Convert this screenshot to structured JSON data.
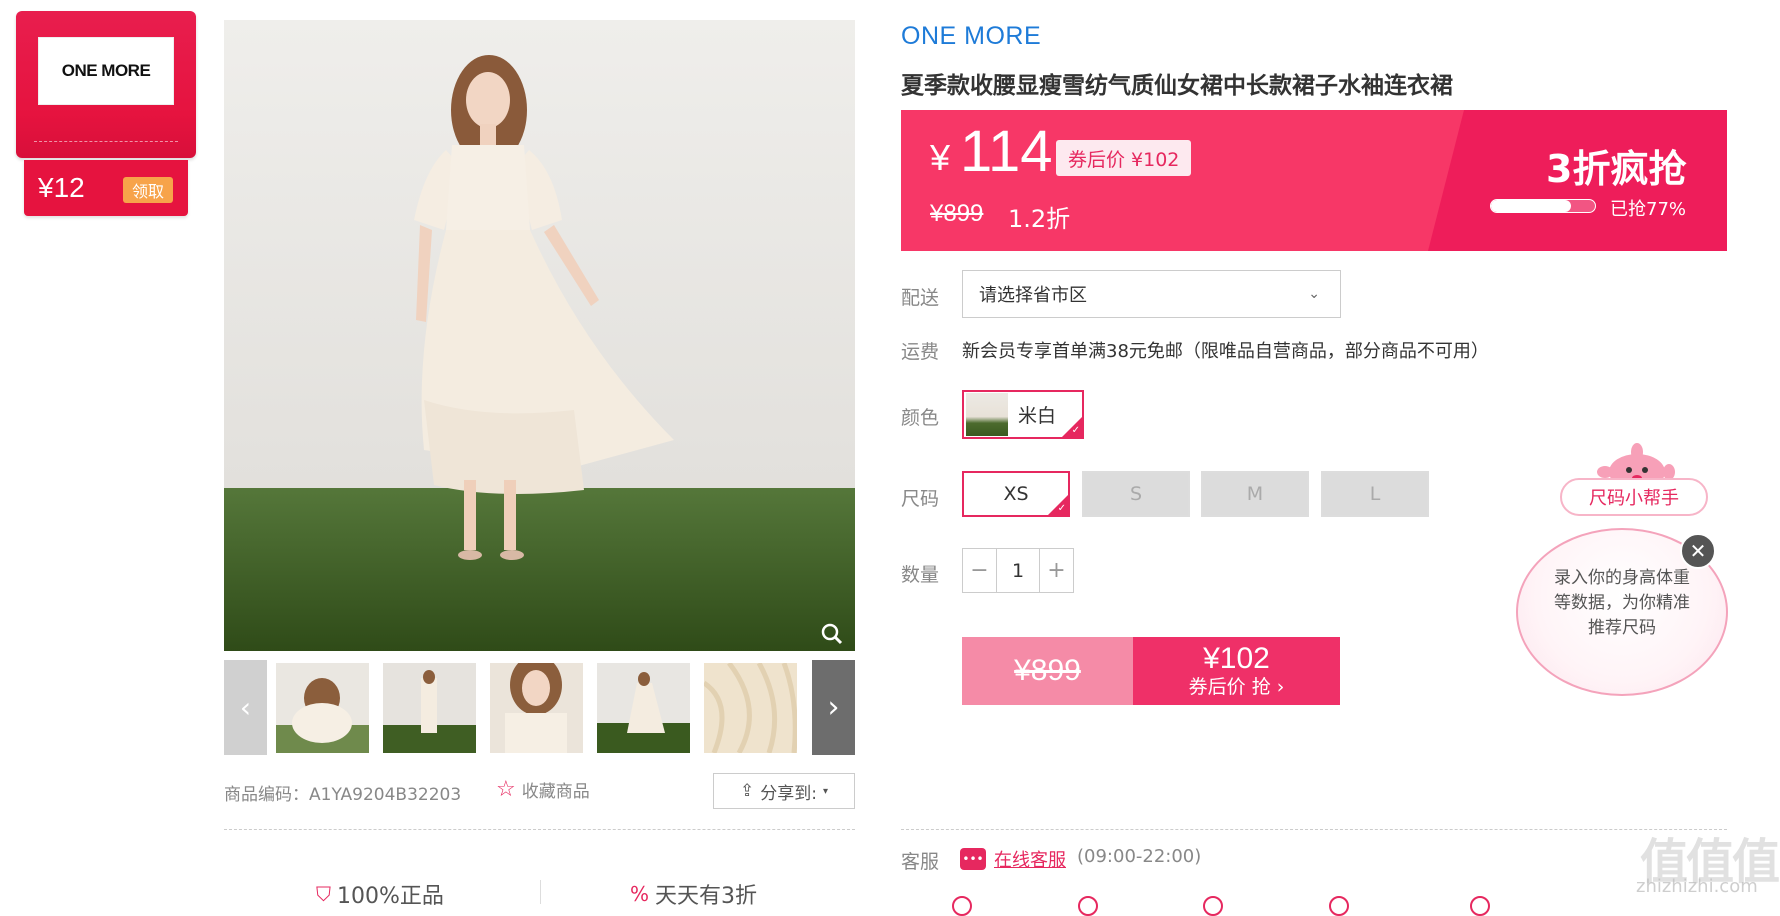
{
  "coupon_card": {
    "brand_logo": "ONE MORE",
    "amount": "¥12",
    "get_label": "领取"
  },
  "gallery": {
    "thumb_count": 5,
    "product_code_label": "商品编码：",
    "product_code": "A1YA9204B32203",
    "favorite_label": "收藏商品",
    "share_label": "分享到:",
    "guarantees": [
      "100%正品",
      "天天有3折"
    ]
  },
  "product": {
    "brand": "ONE MORE",
    "title": "夏季款收腰显瘦雪纺气质仙女裙中长款裙子水袖连衣裙"
  },
  "price": {
    "currency": "¥",
    "current": "114",
    "after_coupon": "券后价 ¥102",
    "original": "¥899",
    "discount": "1.2折",
    "flash_label": "3折疯抢",
    "sold_percent": 0.77,
    "sold_text": "已抢77%"
  },
  "delivery": {
    "label": "配送",
    "region_placeholder": "请选择省市区"
  },
  "shipping": {
    "label": "运费",
    "text": "新会员专享首单满38元免邮（限唯品自营商品，部分商品不可用）"
  },
  "color": {
    "label": "颜色",
    "selected": "米白"
  },
  "size": {
    "label": "尺码",
    "options": [
      "XS",
      "S",
      "M",
      "L"
    ],
    "selected": "XS"
  },
  "quantity": {
    "label": "数量",
    "value": "1",
    "minus": "−",
    "plus": "+"
  },
  "buy": {
    "original": "¥899",
    "price": "¥102",
    "action": "券后价 抢 ›"
  },
  "service": {
    "label": "客服",
    "link": "在线客服",
    "hours": "(09:00-22:00)"
  },
  "size_helper": {
    "pill": "尺码小帮手",
    "bubble_text": "录入你的身高体重等数据，为你精准推荐尺码",
    "close": "✕"
  },
  "watermark": {
    "main": "值值值",
    "sub": "zhizhizhi.com"
  },
  "colors": {
    "accent": "#e6285f",
    "banner": "#f73767",
    "brand_blue": "#1e7bd8"
  }
}
